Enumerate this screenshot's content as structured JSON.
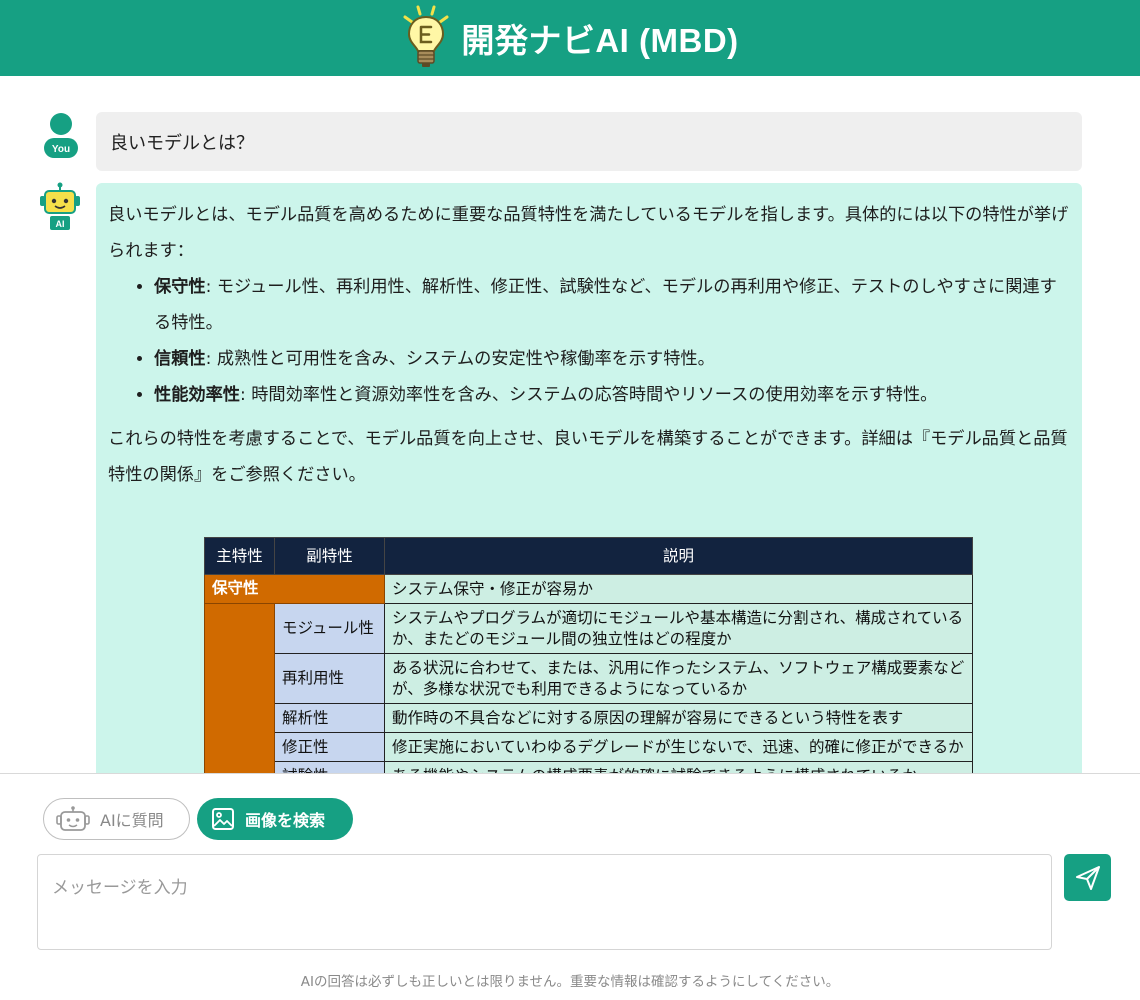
{
  "header": {
    "title": "開発ナビAI (MBD)",
    "logo_icon": "lightbulb-e-icon"
  },
  "chat": {
    "user_avatar_label": "You",
    "ai_avatar_label": "AI",
    "user_message": "良いモデルとは？",
    "ai_response": {
      "intro": "良いモデルとは、モデル品質を高めるために重要な品質特性を満たしているモデルを指します。具体的には以下の特性が挙げられます：",
      "bullets": [
        {
          "term": "保守性",
          "text": ": モジュール性、再利用性、解析性、修正性、試験性など、モデルの再利用や修正、テストのしやすさに関連する特性。"
        },
        {
          "term": "信頼性",
          "text": ": 成熟性と可用性を含み、システムの安定性や稼働率を示す特性。"
        },
        {
          "term": "性能効率性",
          "text": ": 時間効率性と資源効率性を含み、システムの応答時間やリソースの使用効率を示す特性。"
        }
      ],
      "conclusion": "これらの特性を考慮することで、モデル品質を向上させ、良いモデルを構築することができます。詳細は『モデル品質と品質特性の関係』をご参照ください。"
    },
    "table": {
      "headers": [
        "主特性",
        "副特性",
        "説明"
      ],
      "main_characteristic": "保守性",
      "main_description": "システム保守・修正が容易か",
      "rows": [
        {
          "sub": "モジュール性",
          "desc": "システムやプログラムが適切にモジュールや基本構造に分割され、構成されているか、またどのモジュール間の独立性はどの程度か"
        },
        {
          "sub": "再利用性",
          "desc": "ある状況に合わせて、または、汎用に作ったシステム、ソフトウェア構成要素などが、多様な状況でも利用できるようになっているか"
        },
        {
          "sub": "解析性",
          "desc": "動作時の不具合などに対する原因の理解が容易にできるという特性を表す"
        },
        {
          "sub": "修正性",
          "desc": "修正実施においていわゆるデグレードが生じないで、迅速、的確に修正ができるか"
        },
        {
          "sub": "試験性",
          "desc": "ある機能やシステムの構成要素が的確に試験できるように構成されているか"
        }
      ],
      "colors": {
        "header_bg": "#12233f",
        "main_bg": "#d06a00",
        "sub_bg": "#c7d6ef",
        "desc_bg": "#cdeee3"
      }
    }
  },
  "input": {
    "ask_ai_label": "AIに質問",
    "ask_ai_icon": "robot-icon",
    "image_search_label": "画像を検索",
    "image_search_icon": "image-icon",
    "placeholder": "メッセージを入力",
    "send_icon": "send-icon"
  },
  "disclaimer": "AIの回答は必ずしも正しいとは限りません。重要な情報は確認するようにしてください。",
  "colors": {
    "accent": "#16a083",
    "user_bubble": "#efefef",
    "ai_bubble": "#ccf5eb"
  }
}
